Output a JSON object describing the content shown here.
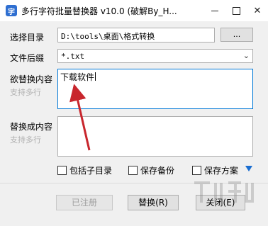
{
  "window": {
    "title": "多行字符批量替换器 v10.0 (破解By_H...",
    "app_icon_glyph": "字",
    "minimize_symbol": "—",
    "close_symbol": "✕"
  },
  "form": {
    "directory_label": "选择目录",
    "directory_value": "D:\\tools\\桌面\\格式转换",
    "browse_label": "...",
    "suffix_label": "文件后缀",
    "suffix_value": "*.txt",
    "find_label": "欲替换内容",
    "find_hint": "支持多行",
    "find_value": "下载软件",
    "replace_label": "替换成内容",
    "replace_hint": "支持多行",
    "replace_value": ""
  },
  "options": {
    "include_subdirs": "包括子目录",
    "save_backup": "保存备份",
    "save_scheme": "保存方案",
    "include_subdirs_checked": false,
    "save_backup_checked": false,
    "save_scheme_checked": false
  },
  "buttons": {
    "registered": "已注册",
    "replace": "替换(R)",
    "close": "关闭(E)"
  },
  "colors": {
    "accent": "#1a6ed1",
    "annotation_arrow": "#c8262d"
  }
}
